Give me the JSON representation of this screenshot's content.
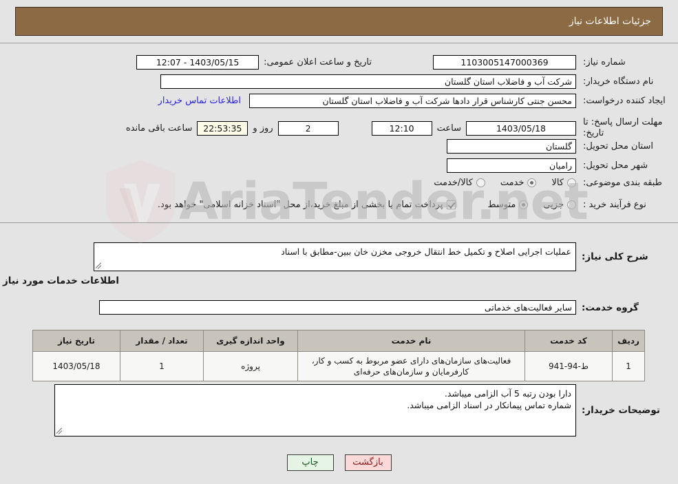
{
  "header": {
    "title": "جزئیات اطلاعات نیاز"
  },
  "form": {
    "need_number_label": "شماره نیاز:",
    "need_number_value": "1103005147000369",
    "announce_datetime_label": "تاریخ و ساعت اعلان عمومی:",
    "announce_datetime_value": "1403/05/15 - 12:07",
    "buyer_org_label": "نام دستگاه خریدار:",
    "buyer_org_value": "شرکت آب و فاضلاب استان گلستان",
    "creator_label": "ایجاد کننده درخواست:",
    "creator_value": "محسن جنتی کارشناس قرار دادها شرکت آب و فاضلاب استان گلستان",
    "buyer_contact_link": "اطلاعات تماس خریدار",
    "deadline_label": "مهلت ارسال پاسخ: تا تاریخ:",
    "deadline_date": "1403/05/18",
    "deadline_hour_label": "ساعت",
    "deadline_hour_value": "12:10",
    "remaining_days_value": "2",
    "remaining_days_label": "روز و",
    "remaining_time_value": "22:53:35",
    "remaining_time_label": "ساعت باقی مانده",
    "province_label": "استان محل تحویل:",
    "province_value": "گلستان",
    "city_label": "شهر محل تحویل:",
    "city_value": "رامیان",
    "category_label": "طبقه بندی موضوعی:",
    "category_options": [
      {
        "label": "کالا",
        "selected": false
      },
      {
        "label": "خدمت",
        "selected": true
      },
      {
        "label": "کالا/خدمت",
        "selected": false
      }
    ],
    "process_label": "نوع فرآیند خرید :",
    "process_options": [
      {
        "label": "جزیی",
        "selected": false
      },
      {
        "label": "متوسط",
        "selected": true
      }
    ],
    "treasury_checkbox_checked": true,
    "treasury_text": "پرداخت تمام یا بخشی از مبلغ خرید،از محل \"اسناد خزانه اسلامی\" خواهد بود."
  },
  "description": {
    "label": "شرح کلی نیاز:",
    "value": "عملیات اجرایی اصلاح و تکمیل خط انتقال خروجی مخزن خان ببین-مطابق با اسناد"
  },
  "services_section": {
    "heading": "اطلاعات خدمات مورد نیاز",
    "group_label": "گروه خدمت:",
    "group_value": "سایر فعالیت‌های خدماتی"
  },
  "table": {
    "headers": [
      "ردیف",
      "کد خدمت",
      "نام خدمت",
      "واحد اندازه گیری",
      "تعداد / مقدار",
      "تاریخ نیاز"
    ],
    "rows": [
      {
        "index": "1",
        "service_code": "ط-94-941",
        "service_name": "فعالیت‌های سازمان‌های دارای عضو مربوط به کسب و کار، کارفرمایان و سازمان‌های حرفه‌ای",
        "unit": "پروژه",
        "quantity": "1",
        "need_date": "1403/05/18"
      }
    ]
  },
  "buyer_notes": {
    "label": "توضیحات خریدار:",
    "lines": [
      "دارا بودن رتبه 5 آب الزامی میباشد.",
      "شماره تماس پیمانکار در اسناد الزامی میباشد."
    ]
  },
  "buttons": {
    "print": "چاپ",
    "back": "بازگشت"
  },
  "watermark": {
    "text": "AriaTender.net"
  },
  "colors": {
    "header_bar": "#8b6a44",
    "page_bg": "#e4e4e4",
    "link": "#2626d8",
    "table_header": "#c8c4bb",
    "btn_print_bg": "#e6f4e6",
    "btn_back_bg": "#fbd9d9"
  }
}
